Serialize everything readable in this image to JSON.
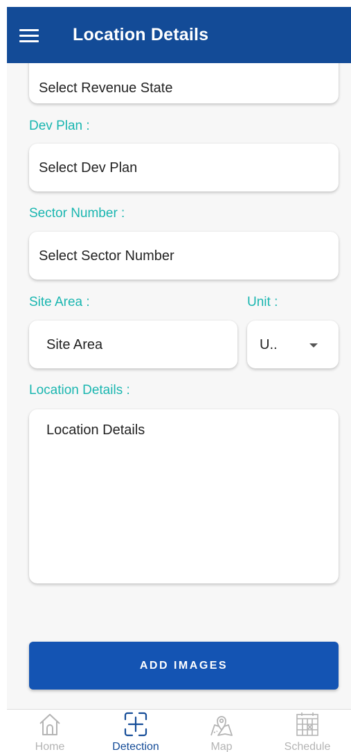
{
  "appbar": {
    "title": "Location Details"
  },
  "form": {
    "revenue_state": {
      "placeholder": "Select Revenue State"
    },
    "dev_plan": {
      "label": "Dev Plan :",
      "placeholder": "Select Dev Plan"
    },
    "sector_number": {
      "label": "Sector Number :",
      "placeholder": "Select Sector Number"
    },
    "site_area": {
      "label": "Site Area :",
      "placeholder": "Site Area"
    },
    "unit": {
      "label": "Unit :",
      "value": "U.."
    },
    "location_details": {
      "label": "Location Details :",
      "placeholder": "Location Details"
    }
  },
  "actions": {
    "add_images": "ADD IMAGES"
  },
  "bottom_nav": {
    "items": [
      {
        "label": "Home",
        "icon": "home-icon"
      },
      {
        "label": "Detection",
        "icon": "detection-icon",
        "active": true
      },
      {
        "label": "Map",
        "icon": "map-icon"
      },
      {
        "label": "Schedule",
        "icon": "schedule-icon"
      }
    ]
  },
  "colors": {
    "primary": "#134b97",
    "button": "#1454b3",
    "label": "#1ab6b0",
    "inactive": "#b4b4b4"
  }
}
